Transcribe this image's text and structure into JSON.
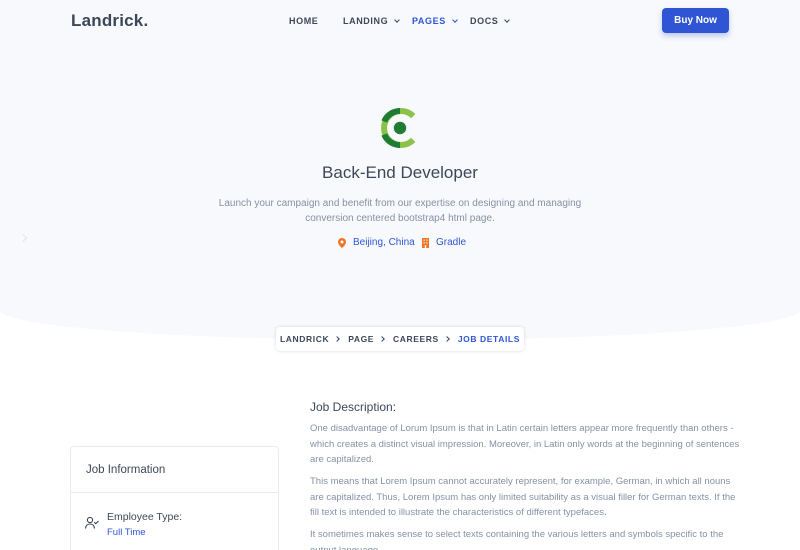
{
  "brand": {
    "logo": "Landrick."
  },
  "nav": {
    "items": [
      {
        "label": "HOME"
      },
      {
        "label": "LANDING"
      },
      {
        "label": "PAGES"
      },
      {
        "label": "DOCS"
      }
    ],
    "buy_label": "Buy Now"
  },
  "hero": {
    "title": "Back-End Developer",
    "description": "Launch your campaign and benefit from our expertise on designing and managing conversion centered bootstrap4 html page.",
    "location": "Beijing, China",
    "company": "Gradle"
  },
  "breadcrumb": {
    "items": [
      "LANDRICK",
      "PAGE",
      "CAREERS",
      "JOB DETAILS"
    ]
  },
  "job_info": {
    "heading": "Job Information",
    "employee_type_label": "Employee Type:",
    "employee_type_value": "Full Time"
  },
  "description": {
    "heading": "Job Description:",
    "paragraphs": [
      "One disadvantage of Lorum Ipsum is that in Latin certain letters appear more frequently than others - which creates a distinct visual impression. Moreover, in Latin only words at the beginning of sentences are capitalized.",
      "This means that Lorem Ipsum cannot accurately represent, for example, German, in which all nouns are capitalized. Thus, Lorem Ipsum has only limited suitability as a visual filler for German texts. If the fill text is intended to illustrate the characteristics of different typefaces.",
      "It sometimes makes sense to select texts containing the various letters and symbols specific to the output language."
    ]
  },
  "colors": {
    "primary": "#2f55d4",
    "accent_orange": "#f17425",
    "heading": "#3c4858",
    "muted": "#8492a6",
    "hero_bg": "#f8f9fc",
    "logo_green_dark": "#1e7d32",
    "logo_green_light": "#8bc34a"
  },
  "icons": {
    "location": "map-pin-icon",
    "company": "building-icon",
    "employee": "user-check-icon"
  }
}
